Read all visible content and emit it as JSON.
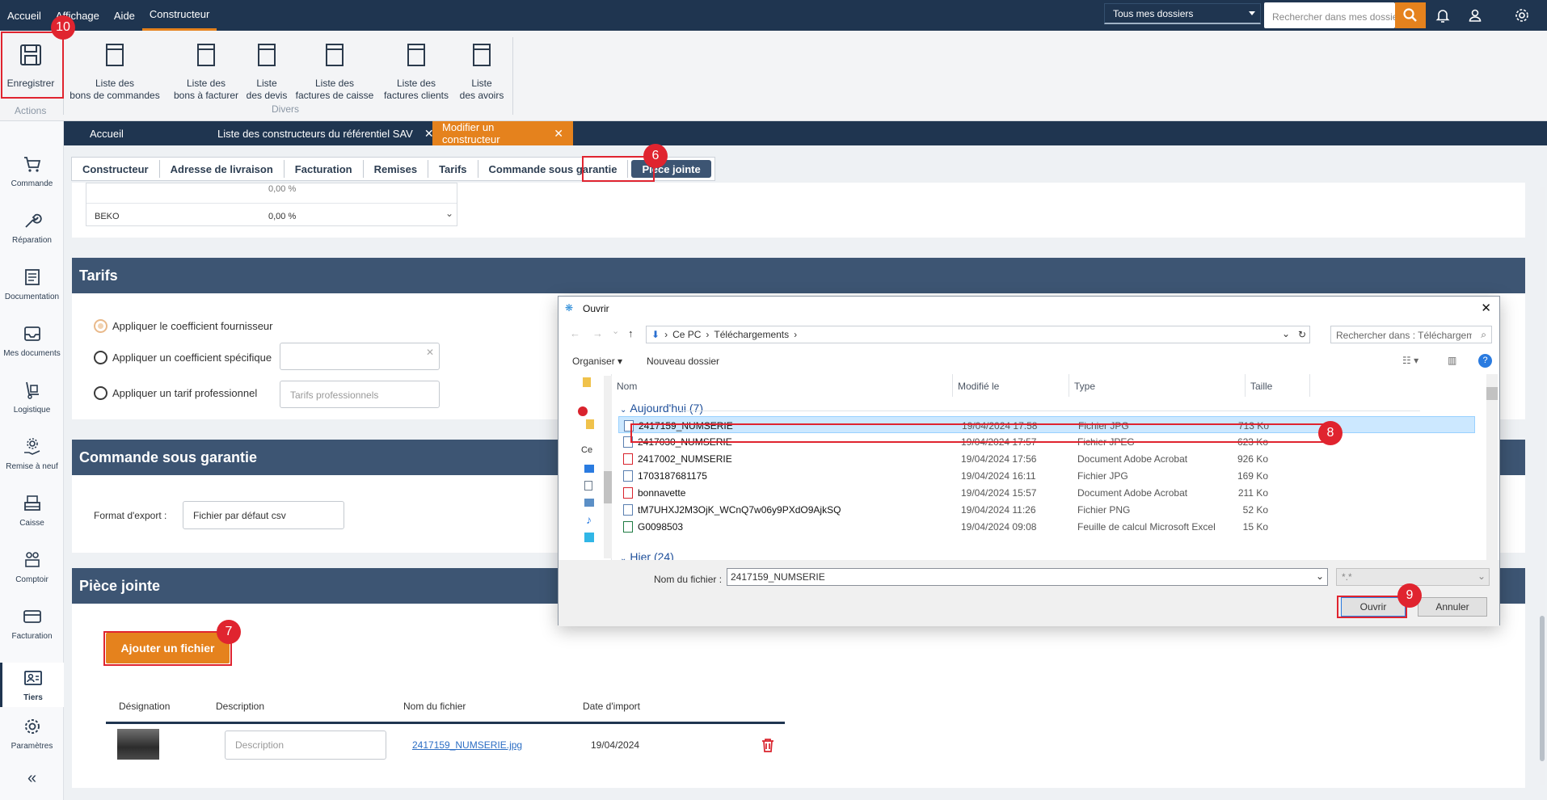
{
  "menu": [
    "Accueil",
    "Affichage",
    "Aide",
    "Constructeur"
  ],
  "folder_select": "Tous mes dossiers",
  "top_search_placeholder": "Rechercher dans mes dossiers",
  "ribbon": {
    "save": "Enregistrer",
    "actions_label": "Actions",
    "divers_label": "Divers",
    "items": [
      {
        "l1": "Liste des",
        "l2": "bons de commandes"
      },
      {
        "l1": "Liste des",
        "l2": "bons à facturer"
      },
      {
        "l1": "Liste",
        "l2": "des devis"
      },
      {
        "l1": "Liste des",
        "l2": "factures de caisse"
      },
      {
        "l1": "Liste des",
        "l2": "factures clients"
      },
      {
        "l1": "Liste",
        "l2": "des avoirs"
      }
    ]
  },
  "sidebar": [
    "Commande",
    "Réparation",
    "Documentation",
    "Mes documents",
    "Logistique",
    "Remise à neuf",
    "Caisse",
    "Comptoir",
    "Facturation",
    "Tiers",
    "Paramètres"
  ],
  "tabs": [
    "Accueil",
    "Liste des constructeurs du référentiel SAV",
    "Modifier un constructeur"
  ],
  "subtabs": [
    "Constructeur",
    "Adresse de livraison",
    "Facturation",
    "Remises",
    "Tarifs",
    "Commande sous garantie",
    "Pièce jointe"
  ],
  "remises": {
    "row1_name": "",
    "row1_value": "0,00 %",
    "row2_name": "BEKO",
    "row2_value": "0,00 %"
  },
  "tarifs": {
    "title": "Tarifs",
    "opt1": "Appliquer le coefficient fournisseur",
    "opt2": "Appliquer un coefficient spécifique",
    "opt3": "Appliquer un tarif professionnel",
    "tarifs_placeholder": "Tarifs professionnels"
  },
  "garantie": {
    "title": "Commande sous garantie",
    "format_label": "Format d'export :",
    "format_value": "Fichier par défaut csv"
  },
  "piece": {
    "title": "Pièce jointe",
    "add_button": "Ajouter un fichier",
    "cols": [
      "Désignation",
      "Description",
      "Nom du fichier",
      "Date d'import"
    ],
    "description_placeholder": "Description",
    "filename": "2417159_NUMSERIE.jpg",
    "date": "19/04/2024"
  },
  "badges": [
    "10",
    "6",
    "7",
    "8",
    "9"
  ],
  "dialog": {
    "title": "Ouvrir",
    "path1": "Ce PC",
    "path2": "Téléchargements",
    "search_placeholder": "Rechercher dans : Téléchargements",
    "organize": "Organiser",
    "new_folder": "Nouveau dossier",
    "cols": [
      "Nom",
      "Modifié le",
      "Type",
      "Taille"
    ],
    "group_today": "Aujourd'hui (7)",
    "group_yesterday": "Hier (24)",
    "files": [
      {
        "name": "2417159_NUMSERIE",
        "date": "19/04/2024 17:58",
        "type": "Fichier JPG",
        "size": "713 Ko"
      },
      {
        "name": "2417030_NUMSERIE",
        "date": "19/04/2024 17:57",
        "type": "Fichier JPEG",
        "size": "623 Ko"
      },
      {
        "name": "2417002_NUMSERIE",
        "date": "19/04/2024 17:56",
        "type": "Document Adobe Acrobat",
        "size": "926 Ko"
      },
      {
        "name": "1703187681175",
        "date": "19/04/2024 16:11",
        "type": "Fichier JPG",
        "size": "169 Ko"
      },
      {
        "name": "bonnavette",
        "date": "19/04/2024 15:57",
        "type": "Document Adobe Acrobat",
        "size": "211 Ko"
      },
      {
        "name": "tM7UHXJ2M3OjK_WCnQ7w06y9PXdO9AjkSQ",
        "date": "19/04/2024 11:26",
        "type": "Fichier PNG",
        "size": "52 Ko"
      },
      {
        "name": "G0098503",
        "date": "19/04/2024 09:08",
        "type": "Feuille de calcul Microsoft Excel",
        "size": "15 Ko"
      }
    ],
    "filename_label": "Nom du fichier :",
    "filename_value": "2417159_NUMSERIE",
    "filter": "*.*",
    "open": "Ouvrir",
    "cancel": "Annuler"
  },
  "colors": {
    "navy": "#1f3550",
    "orange": "#e5821d",
    "section": "#3d5573",
    "red": "#e0242f"
  }
}
